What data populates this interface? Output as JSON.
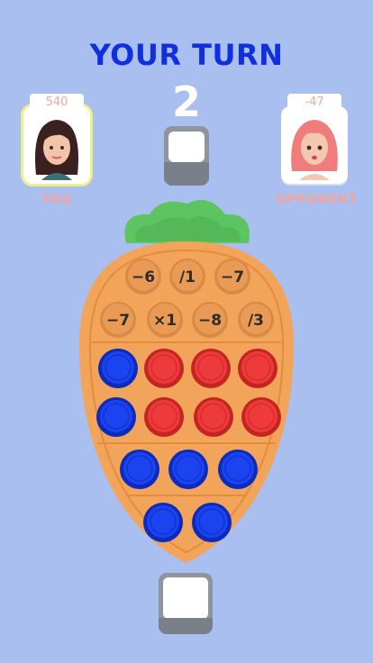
{
  "header": {
    "title": "YOUR TURN",
    "counter": "2"
  },
  "players": {
    "you": {
      "name": "YOU",
      "score": "540"
    },
    "opponent": {
      "name": "OPPONENT",
      "score": "-47"
    }
  },
  "operations": [
    {
      "label": "−6"
    },
    {
      "label": "/1"
    },
    {
      "label": "−7"
    },
    {
      "label": "−7"
    },
    {
      "label": "×1"
    },
    {
      "label": "−8"
    },
    {
      "label": "/3"
    }
  ],
  "bubble_rows": [
    [
      "blue",
      "red",
      "red",
      "red"
    ],
    [
      "blue",
      "red",
      "red",
      "red"
    ],
    [
      "blue",
      "blue",
      "blue"
    ],
    [
      "blue",
      "blue"
    ]
  ],
  "colors": {
    "background": "#a9bff0",
    "title": "#1030e0",
    "board": "#f2a55a",
    "leaves": "#5cc460",
    "bubble_blue": "#1b43f0",
    "bubble_red": "#ee3a3a",
    "label_pink": "#f2a49d"
  }
}
